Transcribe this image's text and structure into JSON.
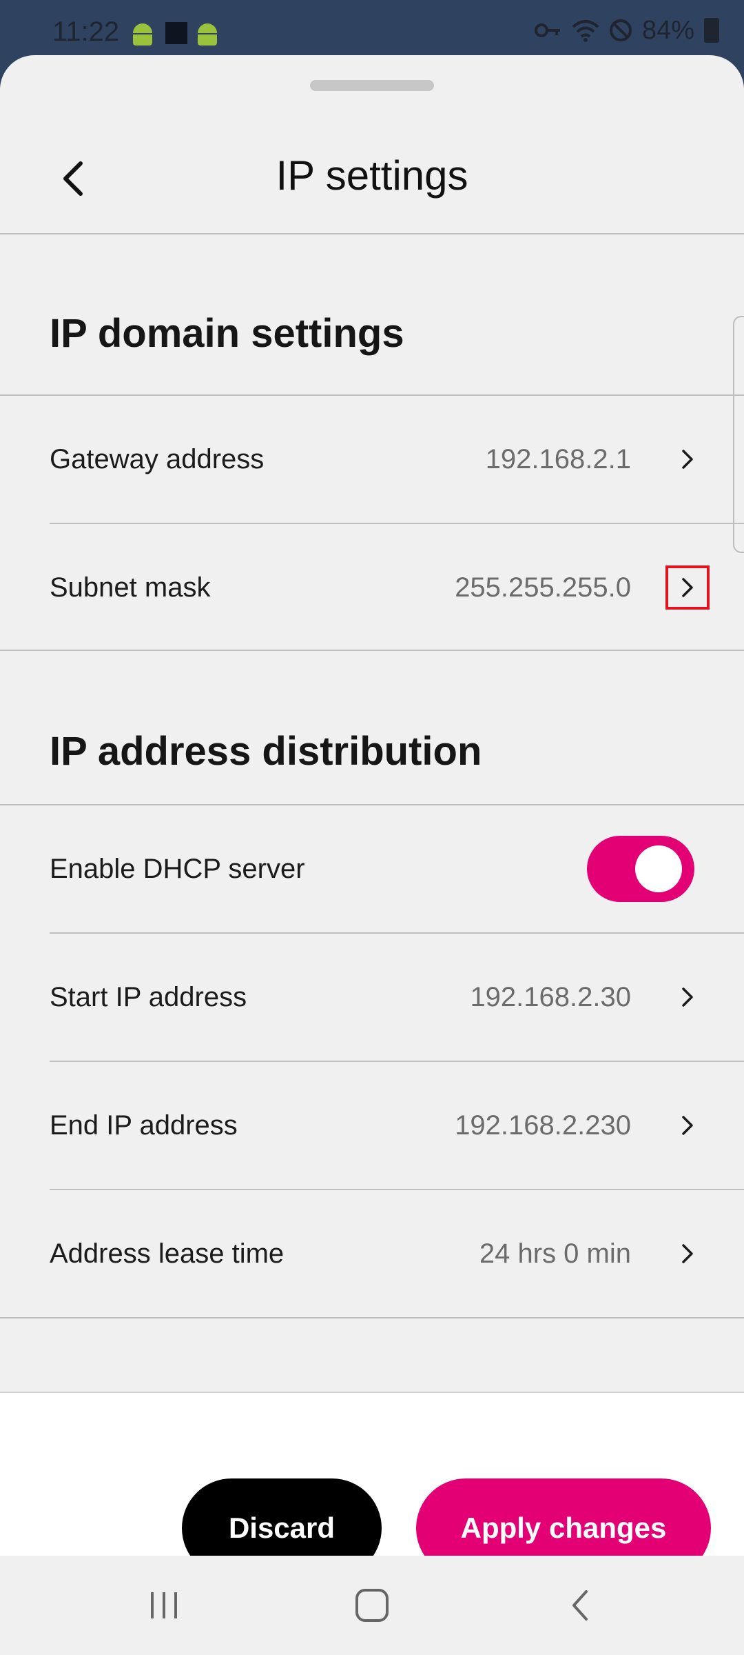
{
  "status_bar": {
    "time": "11:22",
    "battery": "84%",
    "icons": [
      "android-icon",
      "android-icon",
      "square-icon",
      "key-icon",
      "wifi-icon",
      "do-not-disturb-icon",
      "battery-charging-icon"
    ]
  },
  "header": {
    "title": "IP settings",
    "back_icon": "chevron-left-icon"
  },
  "sections": {
    "domain": {
      "title": "IP domain settings",
      "rows": [
        {
          "label": "Gateway address",
          "value": "192.168.2.1"
        },
        {
          "label": "Subnet mask",
          "value": "255.255.255.0"
        }
      ]
    },
    "distribution": {
      "title": "IP address distribution",
      "dhcp": {
        "label": "Enable DHCP server",
        "enabled": true
      },
      "rows": [
        {
          "label": "Start IP address",
          "value": "192.168.2.30"
        },
        {
          "label": "End IP address",
          "value": "192.168.2.230"
        },
        {
          "label": "Address lease time",
          "value": "24 hrs 0 min"
        }
      ]
    }
  },
  "actions": {
    "discard": "Discard",
    "apply": "Apply changes"
  },
  "colors": {
    "accent": "#e20074",
    "status_bar": "#2f4360",
    "sheet_bg": "#f0f0f0",
    "highlight": "#e0141e"
  },
  "nav_bar": {
    "icons": [
      "recents-icon",
      "home-icon",
      "back-icon"
    ]
  }
}
